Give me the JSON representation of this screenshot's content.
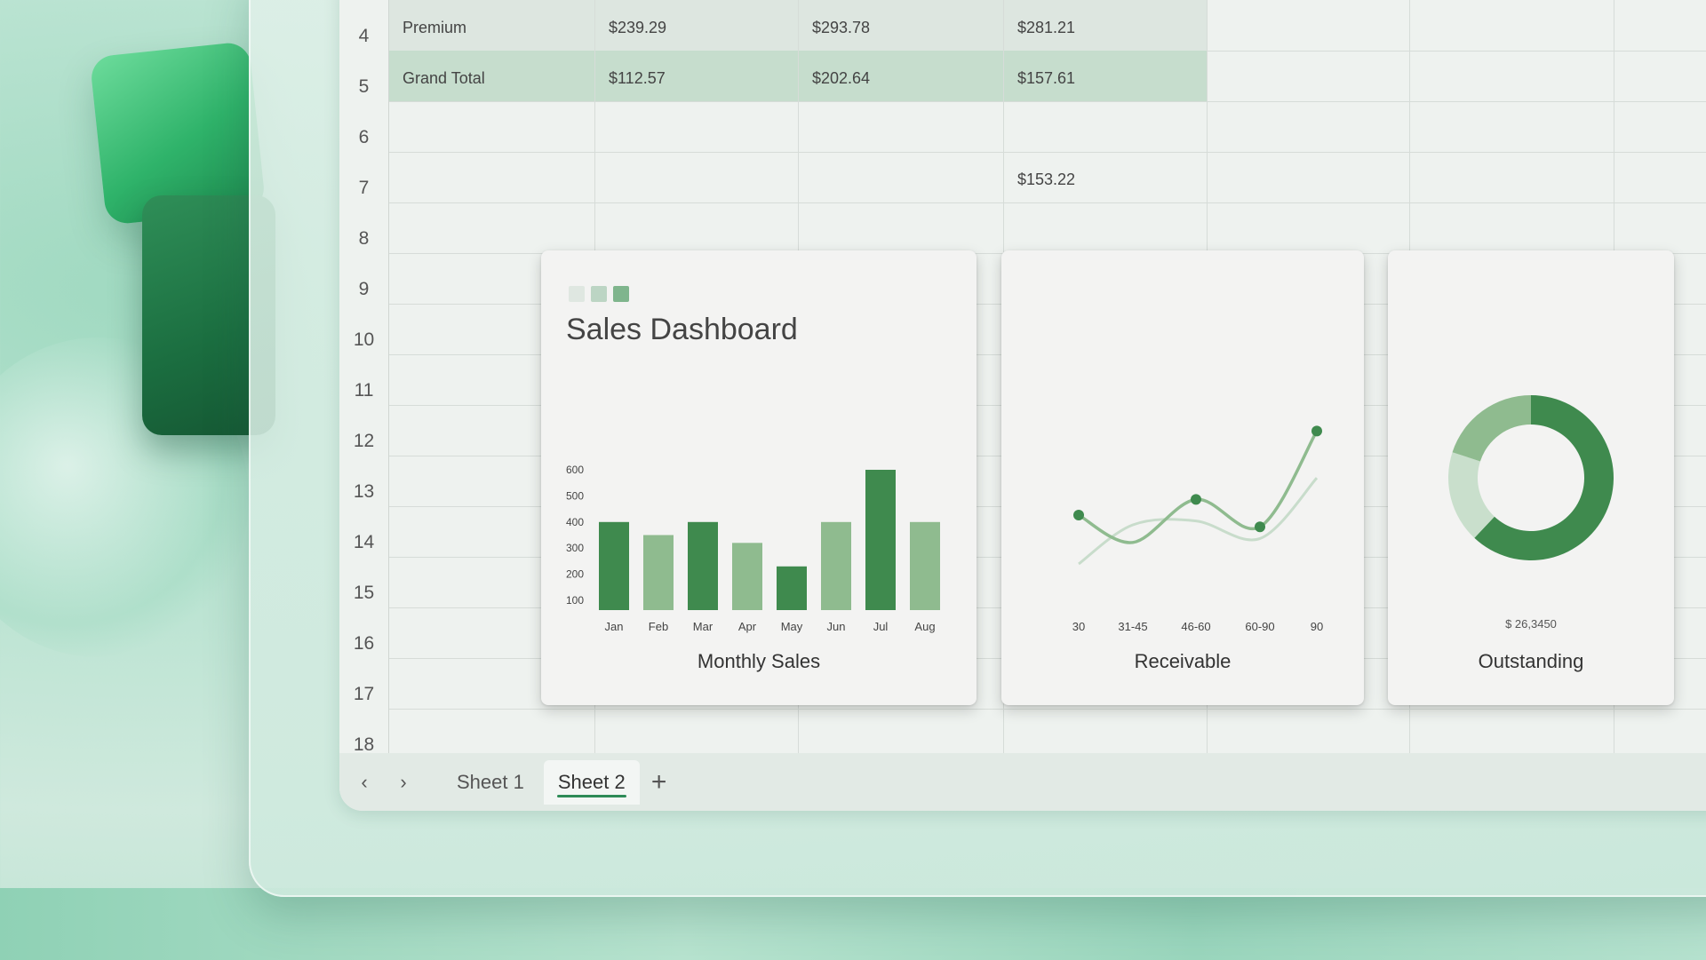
{
  "spreadsheet": {
    "rows": [
      {
        "num": "4",
        "cells": [
          "Premium",
          "$239.29",
          "$293.78",
          "$281.21"
        ]
      },
      {
        "num": "5",
        "cells": [
          "Grand Total",
          "$112.57",
          "$202.64",
          "$157.61"
        ]
      },
      {
        "num": "6",
        "cells": [
          "",
          "",
          "",
          ""
        ]
      },
      {
        "num": "7",
        "cells": [
          "",
          "",
          "",
          "$153.22"
        ]
      },
      {
        "num": "8",
        "cells": [
          "",
          "",
          "",
          ""
        ]
      },
      {
        "num": "9"
      },
      {
        "num": "10"
      },
      {
        "num": "11"
      },
      {
        "num": "12"
      },
      {
        "num": "13"
      },
      {
        "num": "14"
      },
      {
        "num": "15"
      },
      {
        "num": "16"
      },
      {
        "num": "17"
      },
      {
        "num": "18"
      }
    ]
  },
  "tabs": {
    "prev_icon": "chevron-left-icon",
    "next_icon": "chevron-right-icon",
    "items": [
      {
        "label": "Sheet 1",
        "active": false
      },
      {
        "label": "Sheet 2",
        "active": true
      }
    ],
    "add_label": "+"
  },
  "dashboard": {
    "title": "Sales Dashboard",
    "square_colors": [
      "#dfe7e1",
      "#bcd5c4",
      "#7fb58d"
    ]
  },
  "colors": {
    "dark_green": "#3f8a4e",
    "light_green": "#8fbb8f",
    "pale_green": "#c9dfcc"
  },
  "chart_data": [
    {
      "type": "bar",
      "title": "Monthly Sales",
      "categories": [
        "Jan",
        "Feb",
        "Mar",
        "Apr",
        "May",
        "Jun",
        "Jul",
        "Aug"
      ],
      "values": [
        400,
        350,
        400,
        320,
        230,
        400,
        600,
        400
      ],
      "yticks": [
        "600",
        "500",
        "400",
        "300",
        "200",
        "100"
      ],
      "ylim": [
        100,
        600
      ],
      "bar_shades": [
        "dark",
        "light",
        "dark",
        "light",
        "dark",
        "light",
        "dark",
        "light"
      ]
    },
    {
      "type": "line",
      "title": "Receivable",
      "categories": [
        "30",
        "31-45",
        "46-60",
        "60-90",
        "90"
      ],
      "series": [
        {
          "values": [
            3.5,
            2.1,
            4.3,
            2.9,
            7.8
          ]
        },
        {
          "values": [
            1.0,
            3.0,
            3.2,
            2.3,
            5.4
          ]
        }
      ]
    },
    {
      "type": "pie",
      "title": "Outstanding",
      "label": "$ 26,3450",
      "slices": [
        {
          "value": 62,
          "shade": "dark"
        },
        {
          "value": 18,
          "shade": "pale"
        },
        {
          "value": 20,
          "shade": "light"
        }
      ]
    }
  ]
}
